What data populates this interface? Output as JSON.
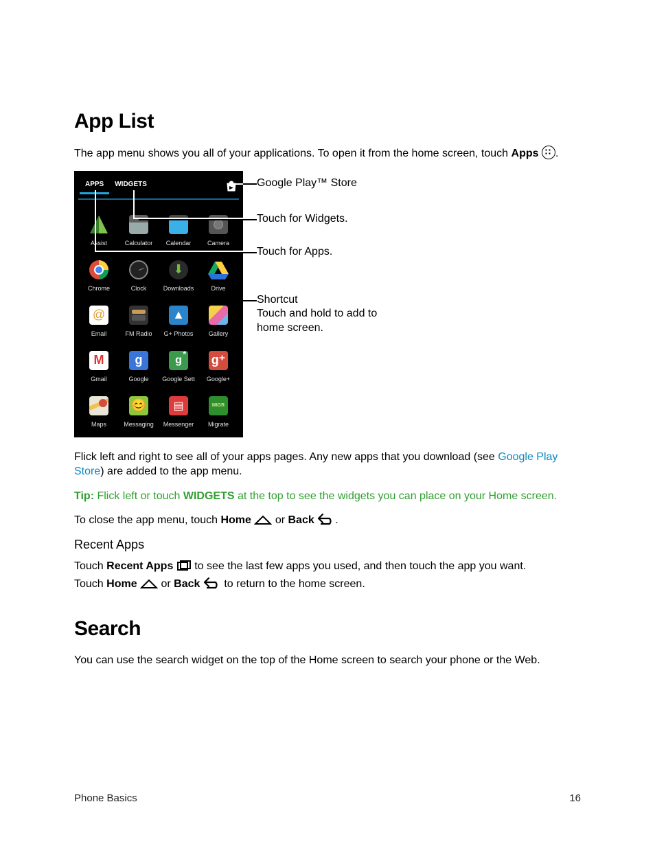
{
  "headings": {
    "app_list": "App List",
    "search": "Search",
    "recent_apps": "Recent Apps"
  },
  "intro": {
    "pre": "The app menu shows you all of your applications. To open it from the home screen, touch ",
    "apps_word": "Apps",
    "post": "."
  },
  "phone": {
    "tab_apps": "APPS",
    "tab_widgets": "WIDGETS",
    "apps": [
      {
        "label": "Assist",
        "style": "assist"
      },
      {
        "label": "Calculator",
        "style": "calc"
      },
      {
        "label": "Calendar",
        "style": "calendar"
      },
      {
        "label": "Camera",
        "style": "camera"
      },
      {
        "label": "Chrome",
        "style": "chrome"
      },
      {
        "label": "Clock",
        "style": "clock"
      },
      {
        "label": "Downloads",
        "style": "dl"
      },
      {
        "label": "Drive",
        "style": "drive"
      },
      {
        "label": "Email",
        "style": "email"
      },
      {
        "label": "FM Radio",
        "style": "radio"
      },
      {
        "label": "G+ Photos",
        "style": "gphotos"
      },
      {
        "label": "Gallery",
        "style": "gallery"
      },
      {
        "label": "Gmail",
        "style": "gmail"
      },
      {
        "label": "Google",
        "style": "g-blue"
      },
      {
        "label": "Google Sett",
        "style": "g-green"
      },
      {
        "label": "Google+",
        "style": "g-red"
      },
      {
        "label": "Maps",
        "style": "maps"
      },
      {
        "label": "Messaging",
        "style": "messaging"
      },
      {
        "label": "Messenger",
        "style": "messenger"
      },
      {
        "label": "Migrate",
        "style": "migrate"
      }
    ]
  },
  "callouts": {
    "play_store": "Google Play™ Store",
    "widgets": "Touch for Widgets.",
    "apps": "Touch for Apps.",
    "shortcut_l1": "Shortcut",
    "shortcut_l2": "Touch and hold to add to",
    "shortcut_l3": "home screen."
  },
  "para_flick": {
    "pre": "Flick left and right to see all of your apps pages. Any new apps that you download (see ",
    "link": "Google Play Store",
    "post": ") are added to the app menu."
  },
  "tip": {
    "label": "Tip:",
    "pre": " Flick left or touch ",
    "widgets": "WIDGETS",
    "post": " at the top to see the widgets you can place on your Home screen."
  },
  "close_line": {
    "pre": "To close the app menu, touch ",
    "home": "Home",
    "mid": " or ",
    "back": "Back",
    "post": "."
  },
  "recent": {
    "l1_pre": "Touch ",
    "l1_bold": "Recent Apps",
    "l1_post": " to see the last few apps you used, and then touch the app you want.",
    "l2_pre": "Touch ",
    "l2_home": "Home",
    "l2_mid": " or ",
    "l2_back": "Back",
    "l2_post": " to return to the home screen."
  },
  "search_body": "You can use the search widget on the top of the Home screen to search your phone or the Web.",
  "footer": {
    "section": "Phone Basics",
    "page": "16"
  }
}
